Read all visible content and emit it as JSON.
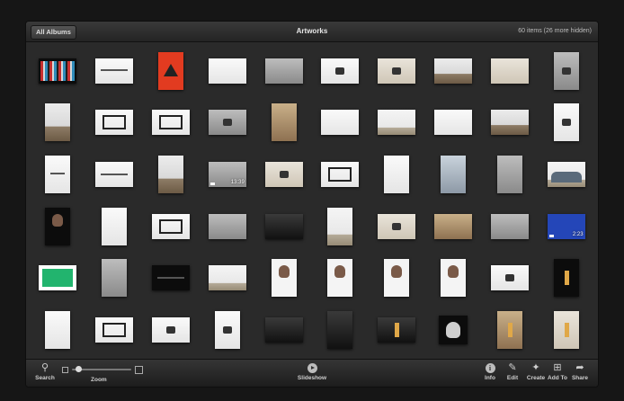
{
  "header": {
    "album_button": "All Albums",
    "title": "Artworks",
    "count": "60 items (26 more hidden)"
  },
  "thumbnails": [
    {
      "shape": "wide",
      "style": "p-black",
      "mark": "mk-grid"
    },
    {
      "shape": "wide",
      "style": "p-white",
      "mark": "mk-scribble"
    },
    {
      "shape": "tall",
      "style": "p-red",
      "mark": "mk-tri"
    },
    {
      "shape": "wide",
      "style": "p-white",
      "mark": ""
    },
    {
      "shape": "wide",
      "style": "p-grey",
      "mark": ""
    },
    {
      "shape": "wide",
      "style": "p-white",
      "mark": "mk-obj"
    },
    {
      "shape": "wide",
      "style": "p-pale",
      "mark": "mk-obj"
    },
    {
      "shape": "wide",
      "style": "p-room",
      "mark": ""
    },
    {
      "shape": "wide",
      "style": "p-pale",
      "mark": ""
    },
    {
      "shape": "tall",
      "style": "p-grey",
      "mark": "mk-obj"
    },
    {
      "shape": "tall",
      "style": "p-room",
      "mark": ""
    },
    {
      "shape": "wide",
      "style": "p-white",
      "mark": "mk-frame"
    },
    {
      "shape": "wide",
      "style": "p-white",
      "mark": "mk-frame"
    },
    {
      "shape": "wide",
      "style": "p-grey",
      "mark": "mk-obj"
    },
    {
      "shape": "tall",
      "style": "p-brown",
      "mark": ""
    },
    {
      "shape": "wide",
      "style": "p-white",
      "mark": ""
    },
    {
      "shape": "wide",
      "style": "p-gallery",
      "mark": ""
    },
    {
      "shape": "wide",
      "style": "p-white",
      "mark": ""
    },
    {
      "shape": "wide",
      "style": "p-room",
      "mark": ""
    },
    {
      "shape": "tall",
      "style": "p-white",
      "mark": "mk-obj"
    },
    {
      "shape": "tall",
      "style": "p-white",
      "mark": "mk-scribble"
    },
    {
      "shape": "wide",
      "style": "p-white",
      "mark": "mk-scribble"
    },
    {
      "shape": "tall",
      "style": "p-room",
      "mark": ""
    },
    {
      "shape": "wide",
      "style": "p-grey",
      "mark": "",
      "duration": "13:39"
    },
    {
      "shape": "wide",
      "style": "p-pale",
      "mark": "mk-obj"
    },
    {
      "shape": "wide",
      "style": "p-white",
      "mark": "mk-frame"
    },
    {
      "shape": "tall",
      "style": "p-white",
      "mark": ""
    },
    {
      "shape": "tall",
      "style": "p-sky",
      "mark": ""
    },
    {
      "shape": "tall",
      "style": "p-grey",
      "mark": ""
    },
    {
      "shape": "wide",
      "style": "p-gallery",
      "mark": "mk-body"
    },
    {
      "shape": "tall",
      "style": "p-black",
      "mark": "mk-face"
    },
    {
      "shape": "tall",
      "style": "p-white",
      "mark": ""
    },
    {
      "shape": "wide",
      "style": "p-white",
      "mark": "mk-frame"
    },
    {
      "shape": "wide",
      "style": "p-grey",
      "mark": ""
    },
    {
      "shape": "wide",
      "style": "p-dark",
      "mark": ""
    },
    {
      "shape": "tall",
      "style": "p-gallery",
      "mark": ""
    },
    {
      "shape": "wide",
      "style": "p-pale",
      "mark": "mk-obj"
    },
    {
      "shape": "wide",
      "style": "p-brown",
      "mark": ""
    },
    {
      "shape": "wide",
      "style": "p-grey",
      "mark": ""
    },
    {
      "shape": "wide",
      "style": "p-blue",
      "mark": "",
      "duration": "2:23"
    },
    {
      "shape": "wide",
      "style": "p-green",
      "mark": "mk-green"
    },
    {
      "shape": "tall",
      "style": "p-grey",
      "mark": ""
    },
    {
      "shape": "wide",
      "style": "p-black",
      "mark": "mk-scribble"
    },
    {
      "shape": "wide",
      "style": "p-gallery",
      "mark": ""
    },
    {
      "shape": "tall",
      "style": "p-portrait",
      "mark": "mk-face"
    },
    {
      "shape": "tall",
      "style": "p-portrait",
      "mark": "mk-face"
    },
    {
      "shape": "tall",
      "style": "p-portrait",
      "mark": "mk-face"
    },
    {
      "shape": "tall",
      "style": "p-portrait",
      "mark": "mk-face"
    },
    {
      "shape": "wide",
      "style": "p-white",
      "mark": "mk-obj"
    },
    {
      "shape": "tall",
      "style": "p-black",
      "mark": "mk-light"
    },
    {
      "shape": "tall",
      "style": "p-white",
      "mark": ""
    },
    {
      "shape": "wide",
      "style": "p-white",
      "mark": "mk-frame"
    },
    {
      "shape": "wide",
      "style": "p-white",
      "mark": "mk-obj"
    },
    {
      "shape": "tall",
      "style": "p-white",
      "mark": "mk-obj"
    },
    {
      "shape": "wide",
      "style": "p-dark",
      "mark": ""
    },
    {
      "shape": "tall",
      "style": "p-dark",
      "mark": ""
    },
    {
      "shape": "wide",
      "style": "p-dark",
      "mark": "mk-light"
    },
    {
      "shape": "square",
      "style": "p-black",
      "mark": "mk-skull"
    },
    {
      "shape": "tall",
      "style": "p-brown",
      "mark": "mk-light"
    },
    {
      "shape": "tall",
      "style": "p-pale",
      "mark": "mk-light"
    }
  ],
  "toolbar": {
    "search": "Search",
    "zoom": "Zoom",
    "zoom_level": 0.1,
    "slideshow": "Slideshow",
    "info": "Info",
    "edit": "Edit",
    "create": "Create",
    "add_to": "Add To",
    "share": "Share"
  }
}
